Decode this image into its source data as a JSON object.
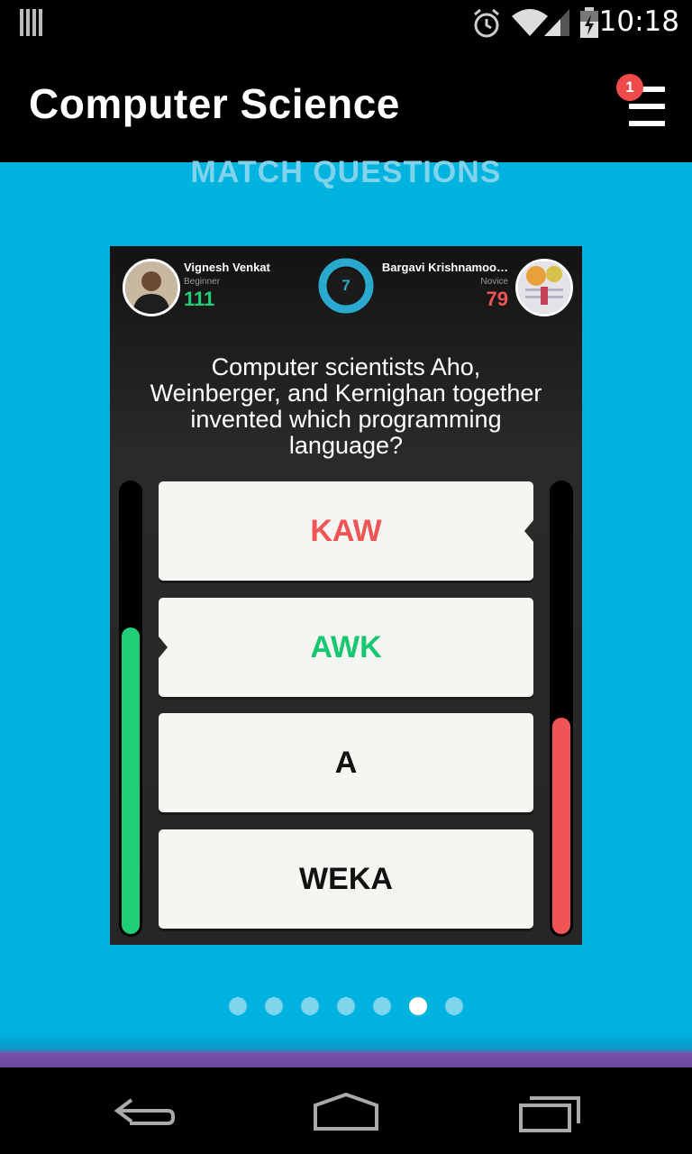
{
  "status_bar": {
    "time": "10:18",
    "icons": [
      "notification-bars-icon",
      "alarm-icon",
      "wifi-icon",
      "signal-icon",
      "battery-charging-icon"
    ]
  },
  "app_bar": {
    "title": "Computer Science",
    "menu_icon": "hamburger-menu-icon",
    "badge_count": "1"
  },
  "section_heading": "MATCH QUESTIONS",
  "match": {
    "player1": {
      "name": "Vignesh Venkat",
      "level": "Beginner",
      "score": "111"
    },
    "player2": {
      "name": "Bargavi Krishnamoo…",
      "level": "Novice",
      "score": "79"
    },
    "timer": "7",
    "question": "Computer scientists Aho, Weinberger, and Kernighan together invented which programming language?",
    "answers": [
      {
        "label": "KAW",
        "color": "#f05454"
      },
      {
        "label": "AWK",
        "color": "#16c76f"
      },
      {
        "label": "A",
        "color": "#111111"
      },
      {
        "label": "WEKA",
        "color": "#111111"
      }
    ],
    "player1_bar_fill": 0.68,
    "player2_bar_fill": 0.48,
    "colors": {
      "player1": "#1fcf77",
      "player2": "#f05454",
      "timer": "#2aa9cf"
    }
  },
  "pagination": {
    "total": 7,
    "active_index": 5
  },
  "nav_bar": {
    "icons": [
      "back-icon",
      "home-icon",
      "recent-apps-icon"
    ]
  }
}
